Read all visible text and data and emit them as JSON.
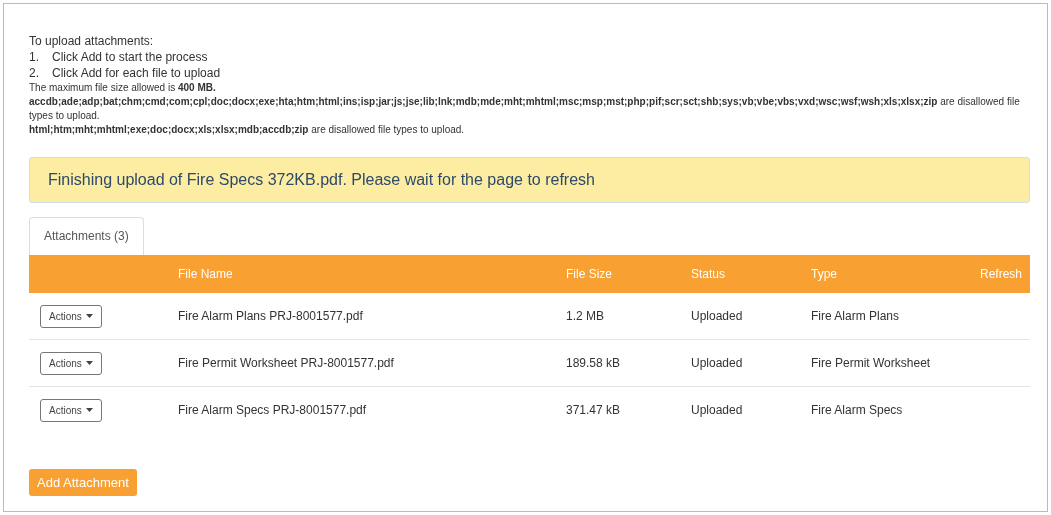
{
  "instructions": {
    "heading": "To upload attachments:",
    "steps": [
      {
        "number": "1.",
        "text": "Click Add to start the process"
      },
      {
        "number": "2.",
        "text": "Click Add for each file to upload"
      }
    ],
    "notes": [
      "The maximum file size allowed is **400 MB.**",
      "**accdb;ade;adp;bat;chm;cmd;com;cpl;doc;docx;exe;hta;htm;html;ins;isp;jar;js;jse;lib;lnk;mdb;mde;mht;mhtml;msc;msp;mst;php;pif;scr;sct;shb;sys;vb;vbe;vbs;vxd;wsc;wsf;wsh;xls;xlsx;zip** are disallowed file types to upload.",
      "**html;htm;mht;mhtml;exe;doc;docx;xls;xlsx;mdb;accdb;zip** are disallowed file types to upload."
    ]
  },
  "alert": "Finishing upload of Fire Specs 372KB.pdf. Please wait for the page to refresh",
  "tabs": [
    {
      "label": "Attachments (3)",
      "selected": true
    }
  ],
  "table": {
    "columns": [
      "File Name",
      "File Size",
      "Status",
      "Type",
      "Refresh"
    ],
    "rows": [
      {
        "action": "Actions",
        "file_name": "Fire Alarm Plans PRJ-8001577.pdf",
        "file_size": "1.2 MB",
        "status": "Uploaded",
        "type": "Fire Alarm Plans"
      },
      {
        "action": "Actions",
        "file_name": "Fire Permit Worksheet PRJ-8001577.pdf",
        "file_size": "189.58 kB",
        "status": "Uploaded",
        "type": "Fire Permit Worksheet"
      },
      {
        "action": "Actions",
        "file_name": "Fire Alarm Specs PRJ-8001577.pdf",
        "file_size": "371.47 kB",
        "status": "Uploaded",
        "type": "Fire Alarm Specs"
      }
    ]
  },
  "add_button": "Add Attachment"
}
